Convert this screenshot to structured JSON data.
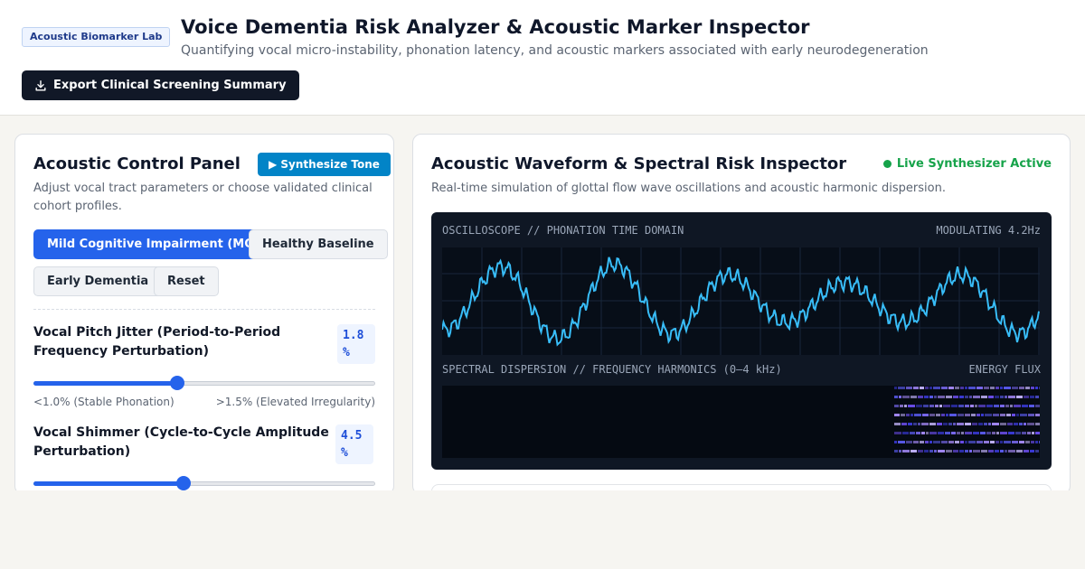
{
  "header": {
    "badge": "Acoustic Biomarker Lab",
    "title": "Voice Dementia Risk Analyzer & Acoustic Marker Inspector",
    "subtitle": "Quantifying vocal micro-instability, phonation latency, and acoustic markers associated with early neurodegeneration",
    "export_label": "Export Clinical Screening Summary",
    "export_icon": "download-icon"
  },
  "control_panel": {
    "title": "Acoustic Control Panel",
    "synth_label": "▶ Synthesize Tone",
    "description": "Adjust vocal tract parameters or choose validated clinical cohort profiles.",
    "presets": [
      {
        "label": "Mild Cognitive Impairment (MCI)",
        "active": true
      },
      {
        "label": "Healthy Baseline",
        "active": false
      },
      {
        "label": "Early Dementia",
        "active": false
      },
      {
        "label": "Reset",
        "active": false
      }
    ],
    "params": [
      {
        "label": "Vocal Pitch Jitter (Period-to-Period Frequency Perturbation)",
        "value": "1.8 %",
        "slider_fraction": 0.42,
        "min_hint": "<1.0% (Stable Phonation)",
        "max_hint": ">1.5% (Elevated Irregularity)"
      },
      {
        "label": "Vocal Shimmer (Cycle-to-Cycle Amplitude Perturbation)",
        "value": "4.5 %",
        "slider_fraction": 0.44
      }
    ]
  },
  "inspector": {
    "title": "Acoustic Waveform & Spectral Risk Inspector",
    "live_label": "Live Synthesizer Active",
    "description": "Real-time simulation of glottal flow wave oscillations and acoustic harmonic dispersion.",
    "scope_label": "OSCILLOSCOPE // PHONATION TIME DOMAIN",
    "scope_status": "MODULATING 4.2Hz",
    "spectral_label": "SPECTRAL DISPERSION // FREQUENCY HARMONICS (0–4 kHz)",
    "spectral_status": "ENERGY FLUX"
  },
  "colors": {
    "accent": "#2563eb",
    "synth": "#0284c7",
    "live": "#16a34a",
    "wave": "#38bdf8",
    "spectrum": "#8b5cf6"
  }
}
